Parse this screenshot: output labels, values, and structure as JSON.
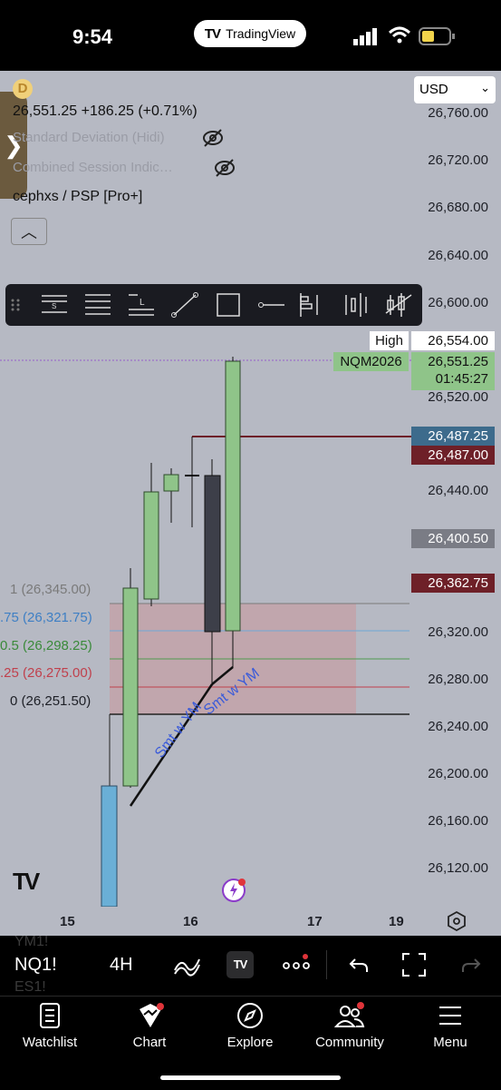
{
  "status_bar": {
    "time": "9:54",
    "app_pill": "TradingView"
  },
  "currency": {
    "selected": "USD"
  },
  "legend": {
    "badge": "D",
    "price_line": "26,551.25  +186.25 (+0.71%)",
    "indicators": [
      "Standard Deviation (Hidi)",
      "Combined Session Indic…",
      "cephxs / PSP [Pro+]"
    ]
  },
  "toolbar": {
    "tools": [
      "drag-handle",
      "s-levels",
      "multi-lines",
      "l-lines",
      "trend-line",
      "rectangle",
      "horizontal-ray",
      "volume-profile",
      "single-bar",
      "bars",
      "candles-cross"
    ]
  },
  "price_axis": {
    "ticks": [
      "26,760.00",
      "26,720.00",
      "26,680.00",
      "26,640.00",
      "26,600.00",
      "26,520.00",
      "26,440.00",
      "26,320.00",
      "26,280.00",
      "26,240.00",
      "26,200.00",
      "26,160.00",
      "26,120.00"
    ],
    "high_label": "High",
    "high_value": "26,554.00",
    "symbol_tag": "NQM2026",
    "last_price": "26,551.25",
    "countdown": "01:45:27",
    "level_blue": "26,487.25",
    "level_red": "26,487.00",
    "level_gray": "26,400.50",
    "level_red2": "26,362.75"
  },
  "fib_labels": [
    "1 (26,345.00)",
    ".75 (26,321.75)",
    "0.5 (26,298.25)",
    ".25 (26,275.00)",
    "0 (26,251.50)"
  ],
  "annotations": [
    "Smt w YM",
    "Smt w YM"
  ],
  "x_axis": [
    "15",
    "16",
    "17",
    "19"
  ],
  "symbol_bar": {
    "ghost_top": "YM1!",
    "symbol": "NQ1!",
    "ghost_bottom": "ES1!",
    "interval": "4H"
  },
  "tabs": [
    "Watchlist",
    "Chart",
    "Explore",
    "Community",
    "Menu"
  ],
  "colors": {
    "bull": "#8fc489",
    "bear": "#3d3f49",
    "zone": "#c4a0a6",
    "accent_red": "#6e2028",
    "accent_blue": "#3d6b8c"
  }
}
